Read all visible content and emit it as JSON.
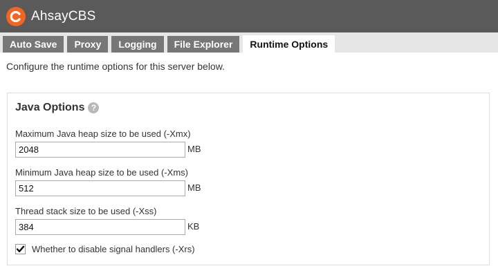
{
  "app": {
    "title": "AhsayCBS",
    "brand_color": "#f26522",
    "logo_icon": "ahsay-logo-icon"
  },
  "tabs": [
    {
      "label": "Auto Save",
      "active": false
    },
    {
      "label": "Proxy",
      "active": false
    },
    {
      "label": "Logging",
      "active": false
    },
    {
      "label": "File Explorer",
      "active": false
    },
    {
      "label": "Runtime Options",
      "active": true
    }
  ],
  "intro_text": "Configure the runtime options for this server below.",
  "java_options": {
    "title": "Java Options",
    "help_icon": "help-icon",
    "max_heap": {
      "label": "Maximum Java heap size to be used (-Xmx)",
      "value": "2048",
      "unit": "MB"
    },
    "min_heap": {
      "label": "Minimum Java heap size to be used (-Xms)",
      "value": "512",
      "unit": "MB"
    },
    "thread_stack": {
      "label": "Thread stack size to be used (-Xss)",
      "value": "384",
      "unit": "KB"
    },
    "disable_signal_handlers": {
      "label": "Whether to disable signal handlers (-Xrs)",
      "checked": true
    }
  }
}
